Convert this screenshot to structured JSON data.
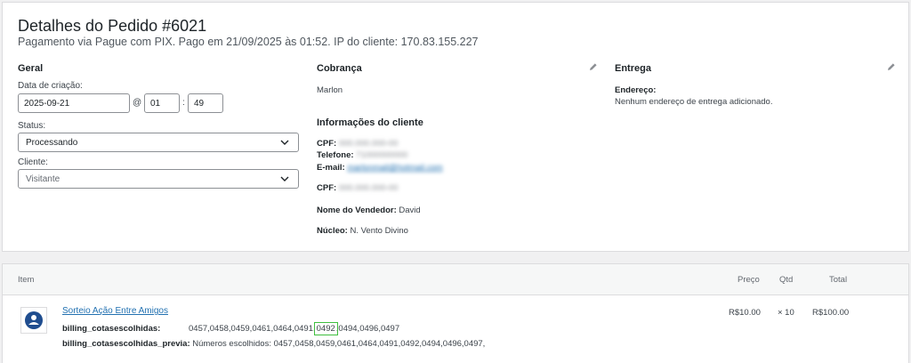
{
  "order": {
    "title": "Detalhes do Pedido #6021",
    "subtitle": "Pagamento via Pague com PIX. Pago em 21/09/2025 às 01:52. IP do cliente: 170.83.155.227"
  },
  "general": {
    "heading": "Geral",
    "date_label": "Data de criação:",
    "date_value": "2025-09-21",
    "at_symbol": "@",
    "hour_value": "01",
    "time_separator": ":",
    "minute_value": "49",
    "status_label": "Status:",
    "status_value": "Processando",
    "customer_label": "Cliente:",
    "customer_value": "Visitante"
  },
  "billing": {
    "heading": "Cobrança",
    "name": "Marlon",
    "customer_info_heading": "Informações do cliente",
    "cpf_label": "CPF:",
    "cpf_value": "000.000.000-00",
    "phone_label": "Telefone:",
    "phone_value": "71000000000",
    "email_label": "E-mail:",
    "email_value": "marlonmail@hotmail.com",
    "cpf2_label": "CPF:",
    "cpf2_value": "000.000.000-00",
    "seller_label": "Nome do Vendedor:",
    "seller_value": "David",
    "nucleus_label": "Núcleo:",
    "nucleus_value": "N. Vento Divino"
  },
  "shipping": {
    "heading": "Entrega",
    "address_label": "Endereço:",
    "address_value": "Nenhum endereço de entrega adicionado."
  },
  "items": {
    "headers": {
      "item": "Item",
      "price": "Preço",
      "qty": "Qtd",
      "total": "Total"
    },
    "rows": [
      {
        "name": "Sorteio Ação Entre Amigos",
        "meta1_key": "billing_cotasescolhidas:",
        "meta1_before": "0457,0458,0459,0461,0464,0491,",
        "meta1_highlight": "0492",
        "meta1_after": ",0494,0496,0497",
        "meta2_key": "billing_cotasescolhidas_previa:",
        "meta2_value": "Números escolhidos: 0457,0458,0459,0461,0464,0491,0492,0494,0496,0497,",
        "price": "R$10.00",
        "qty": "× 10",
        "total": "R$100.00"
      }
    ]
  },
  "colors": {
    "link": "#2271b1",
    "highlight": "#3fbf3f",
    "background": "#f0f0f1"
  }
}
